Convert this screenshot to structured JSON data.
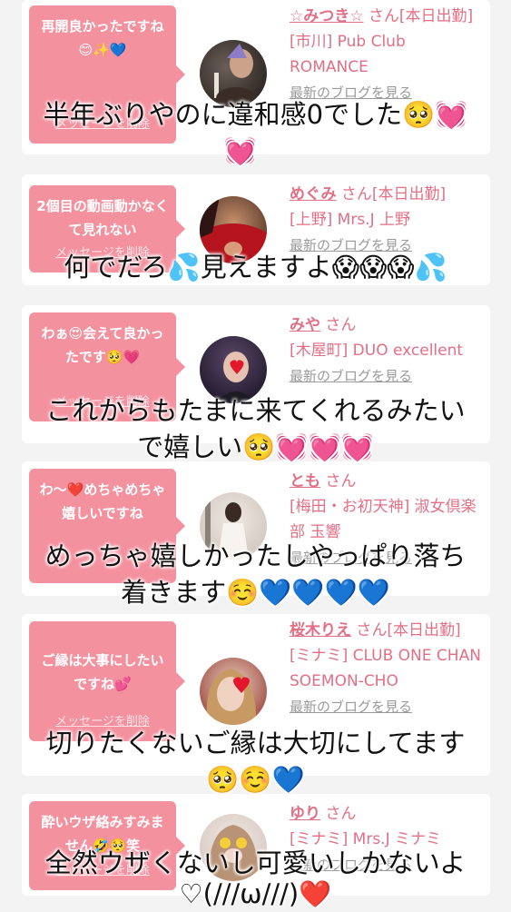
{
  "delete_label": "メッセージを削除",
  "blog_label": "最新のブログを見る",
  "cards": [
    {
      "bubble": "再開良かったですね😊✨💙",
      "name": "☆みつき☆",
      "suffix": "さん[本日出勤]",
      "shop": "[市川] Pub Club ROMANCE",
      "avatar_icon": "woman-with-champagne-icon",
      "overlay": [
        "半年ぶりやのに違和感0でした🥺💓",
        "💓"
      ]
    },
    {
      "bubble": "2個目の動画動かなくて見れない",
      "name": "めぐみ",
      "suffix": "さん[本日出勤]",
      "shop": "[上野] Mrs.J 上野",
      "avatar_icon": "woman-red-dress-icon",
      "overlay": [
        "何でだろ💦見えますよ😱😱😱💦"
      ]
    },
    {
      "bubble": "わぁ😍会えて良かったです🥺💗",
      "name": "みや",
      "suffix": "さん",
      "shop": "[木屋町] DUO excellent",
      "avatar_icon": "woman-heart-icon",
      "overlay": [
        "これからもたまに来てくれるみたい",
        "で嬉しい🥺💓💓💓"
      ]
    },
    {
      "bubble": "わ〜❤️めちゃめちゃ嬉しいですね",
      "name": "とも",
      "suffix": "さん",
      "shop": "[梅田・お初天神] 淑女倶楽部 玉響",
      "avatar_icon": "woman-white-dress-icon",
      "overlay": [
        "めっちゃ嬉しかったしやっぱり落ち",
        "着きます☺️💙💙💙💙"
      ]
    },
    {
      "bubble": "ご縁は大事にしたいですね💕",
      "name": "桜木りえ",
      "suffix": "さん[本日出勤]",
      "shop": "[ミナミ] CLUB ONE CHAN SOEMON-CHO",
      "avatar_icon": "woman-selfie-heart-icon",
      "overlay": [
        "切りたくないご縁は大切にしてます",
        "🥺☺️💙"
      ]
    },
    {
      "bubble": "酔いウザ絡みすみません🤣🥺笑",
      "name": "ゆり",
      "suffix": "さん",
      "shop": "[ミナミ] Mrs.J ミナミ",
      "avatar_icon": "woman-emoji-face-icon",
      "overlay": [
        "全然ウザくないし可愛いしかないよ",
        "♡(///ω///)❤️"
      ]
    }
  ]
}
